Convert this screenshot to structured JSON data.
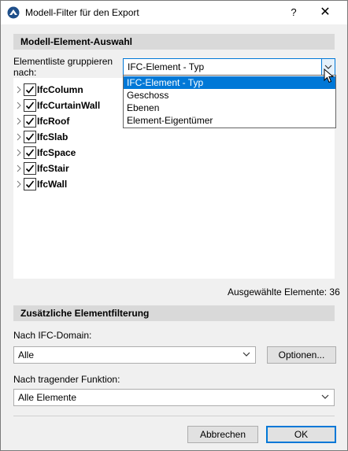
{
  "window": {
    "title": "Modell-Filter für den Export",
    "help_glyph": "?",
    "close_glyph": "✕"
  },
  "model_selection": {
    "header": "Modell-Element-Auswahl",
    "group_label_line1": "Elementliste gruppieren",
    "group_label_line2": "nach:",
    "group_value": "IFC-Element - Typ",
    "group_options": [
      "IFC-Element - Typ",
      "Geschoss",
      "Ebenen",
      "Element-Eigentümer"
    ],
    "selected_option_index": 0,
    "tree_items": [
      {
        "label": "IfcColumn",
        "checked": true
      },
      {
        "label": "IfcCurtainWall",
        "checked": true
      },
      {
        "label": "IfcRoof",
        "checked": true
      },
      {
        "label": "IfcSlab",
        "checked": true
      },
      {
        "label": "IfcSpace",
        "checked": true
      },
      {
        "label": "IfcStair",
        "checked": true
      },
      {
        "label": "IfcWall",
        "checked": true
      }
    ],
    "selected_count_text": "Ausgewählte Elemente: 36"
  },
  "additional_filter": {
    "header": "Zusätzliche Elementfilterung",
    "domain_label": "Nach IFC-Domain:",
    "domain_value": "Alle",
    "options_button": "Optionen...",
    "function_label": "Nach tragender Funktion:",
    "function_value": "Alle Elemente"
  },
  "footer": {
    "cancel_button": "Abbrechen",
    "ok_button": "OK"
  },
  "colors": {
    "accent": "#0078d7",
    "section_bg": "#d9d9d9",
    "window_bg": "#f0f0f0"
  }
}
